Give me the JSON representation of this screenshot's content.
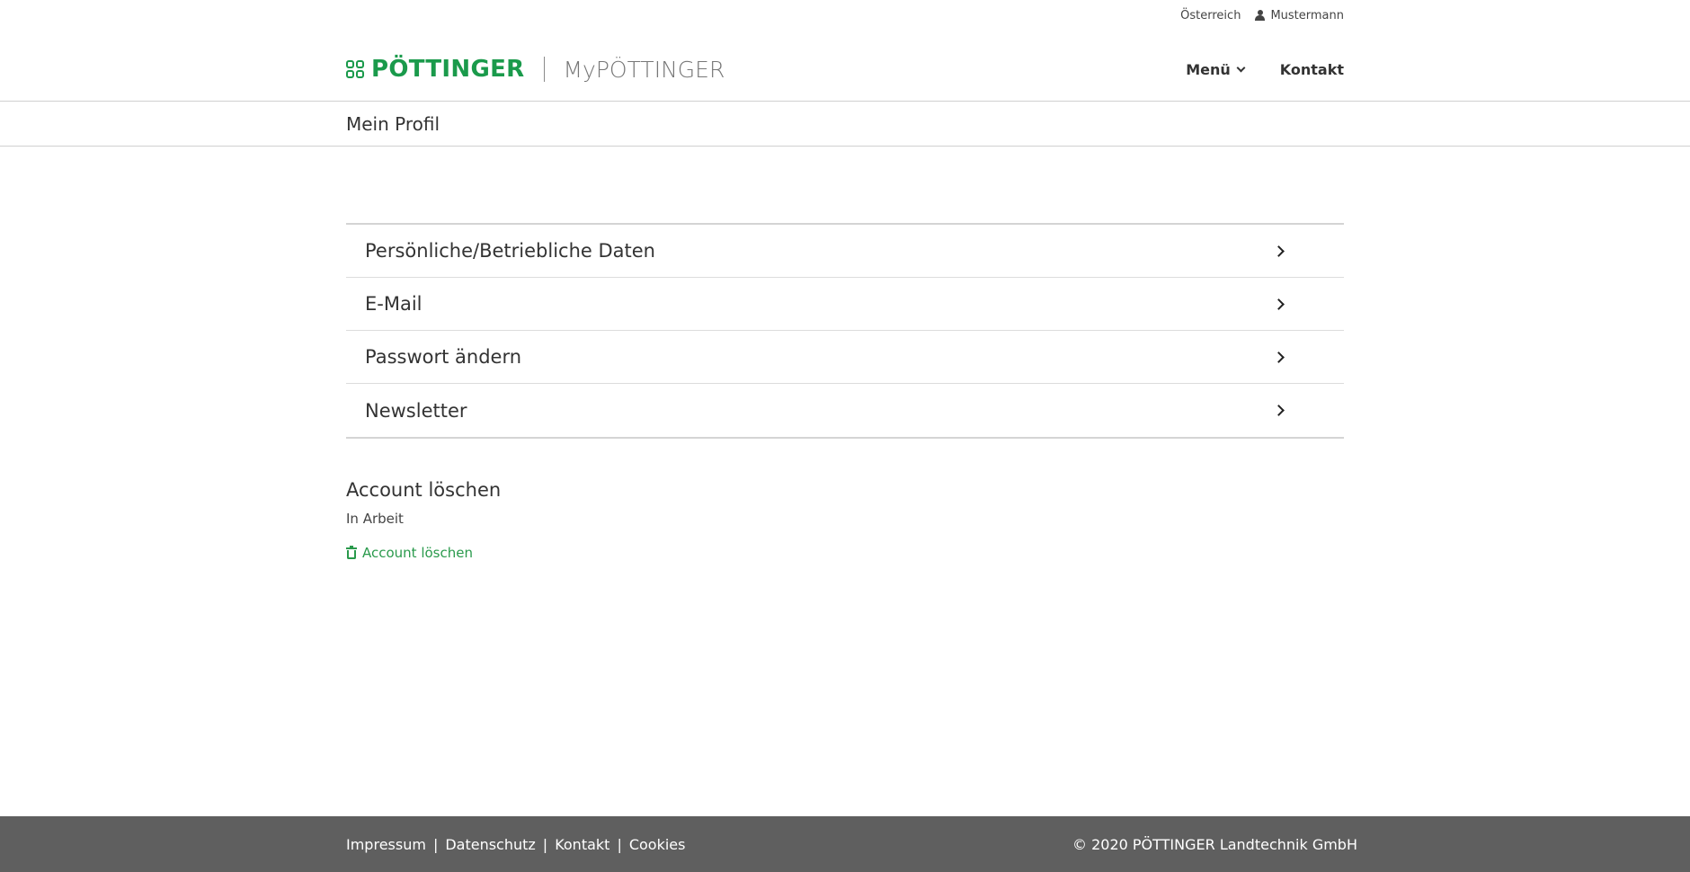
{
  "topbar": {
    "country": "Österreich",
    "user_name": "Mustermann"
  },
  "brand": {
    "logo_text": "PÖTTINGER",
    "sub_title": "MyPÖTTINGER",
    "color": "#1a9a4b"
  },
  "nav": {
    "menu_label": "Menü",
    "contact_label": "Kontakt"
  },
  "page": {
    "title": "Mein Profil"
  },
  "profile_list": [
    {
      "label": "Persönliche/Betriebliche Daten"
    },
    {
      "label": "E-Mail"
    },
    {
      "label": "Passwort ändern"
    },
    {
      "label": "Newsletter"
    }
  ],
  "account_delete": {
    "heading": "Account löschen",
    "status": "In Arbeit",
    "link_label": "Account löschen",
    "link_color": "#2a9a4c"
  },
  "footer": {
    "links": [
      "Impressum",
      "Datenschutz",
      "Kontakt",
      "Cookies"
    ],
    "separator": "|",
    "copyright": "© 2020 PÖTTINGER Landtechnik GmbH",
    "background": "#5f5f5f"
  }
}
